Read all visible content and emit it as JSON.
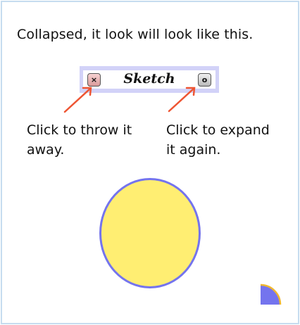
{
  "heading": "Collapsed, it look will look like this.",
  "sketch": {
    "title": "Sketch",
    "close_glyph": "×",
    "expand_glyph": "o",
    "close_icon": "close-icon",
    "expand_icon": "expand-icon"
  },
  "captions": {
    "close_line1": "Click to throw it",
    "close_line2": "away.",
    "expand_line1": "Click to expand",
    "expand_line2": "it again."
  },
  "colors": {
    "morph_border": "#d2d2f8",
    "arrow": "#ee5533",
    "sun_fill": "#ffee72",
    "sun_border": "#7474ee",
    "corner_fill": "#7474ee",
    "corner_edge": "#f0b830"
  }
}
